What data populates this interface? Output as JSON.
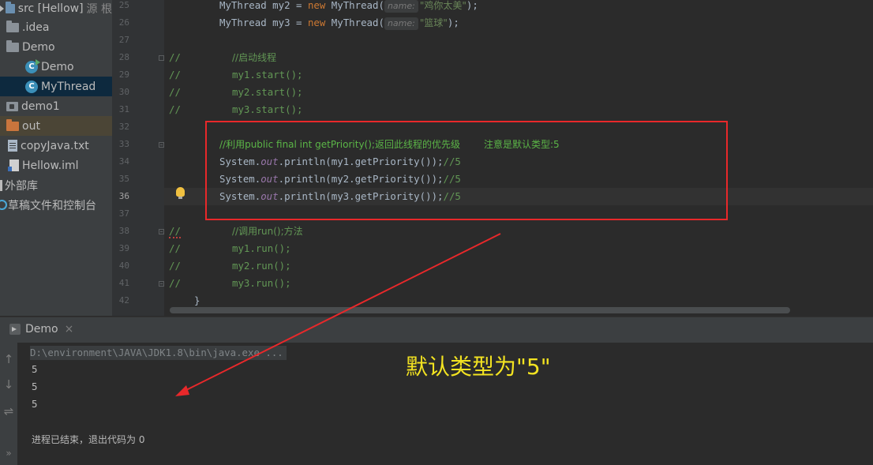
{
  "project_tree": [
    {
      "name": "src-root",
      "icon": "folder-icon",
      "label": "src [Hellow]",
      "suffix": "源 根",
      "top": 0
    },
    {
      "name": "idea-folder",
      "icon": "folder-icon",
      "label": ".idea",
      "top": 0
    },
    {
      "name": "demo-package",
      "icon": "package-icon",
      "label": "Demo",
      "top": 0
    },
    {
      "name": "demo-class",
      "icon": "class-icon",
      "label": "Demo",
      "top": 0
    },
    {
      "name": "mythread-class",
      "icon": "class-icon",
      "label": "MyThread",
      "top": 0
    },
    {
      "name": "demo1-module",
      "icon": "module-icon",
      "label": "demo1",
      "top": 0
    },
    {
      "name": "out-folder",
      "icon": "folder-icon",
      "label": "out",
      "top": 0
    },
    {
      "name": "copyjava-file",
      "icon": "text-file-icon",
      "label": "copyJava.txt",
      "top": 0
    },
    {
      "name": "hellow-iml-file",
      "icon": "iml-file-icon",
      "label": "Hellow.iml",
      "top": 0
    },
    {
      "name": "external-libs",
      "icon": "library-icon",
      "label": "外部库",
      "top": 0
    },
    {
      "name": "scratches",
      "icon": "console-icon",
      "label": "草稿文件和控制台",
      "top": 0
    }
  ],
  "code": {
    "line_numbers": [
      "25",
      "26",
      "27",
      "28",
      "29",
      "30",
      "31",
      "32",
      "33",
      "34",
      "35",
      "36",
      "37",
      "38",
      "39",
      "40",
      "41",
      "42"
    ],
    "class_name": "MyThread",
    "new_keyword": "new",
    "param_hint": "name:",
    "var_my2": "my2",
    "var_my3": "my3",
    "str_my2": "\"鸡你太美\"",
    "str_my3": "\"篮球\"",
    "comment_slash": "//",
    "comment_start_threads": "//启动线程",
    "start_my1": "my1.start();",
    "start_my2": "my2.start();",
    "start_my3": "my3.start();",
    "priority_comment": "//利用public final int getPriority();返回此线程的优先级",
    "priority_note": "注意是默认类型:5",
    "sys_prefix": "System.",
    "sys_out": "out",
    "println_my1": ".println(my1.getPriority());",
    "println_my2": ".println(my2.getPriority());",
    "println_my3": ".println(my3.getPriority());",
    "trail_comment": "//5",
    "comment_call_run": "//调用run();方法",
    "run_my1": "my1.run();",
    "run_my2": "my2.run();",
    "run_my3": "my3.run();",
    "close_brace": "}"
  },
  "run_panel": {
    "tab_label": "Demo",
    "close_glyph": "×",
    "command": "D:\\environment\\JAVA\\JDK1.8\\bin\\java.exe ...",
    "outputs": [
      "5",
      "5",
      "5"
    ],
    "exit_message": "进程已结束，退出代码为 0",
    "toolbar": {
      "up": "↑",
      "down": "↓",
      "wrap": "⇌",
      "more": "»"
    }
  },
  "annotation": {
    "text": "默认类型为\"5\"",
    "color": "#f3e321",
    "box_color": "#e8282a"
  }
}
